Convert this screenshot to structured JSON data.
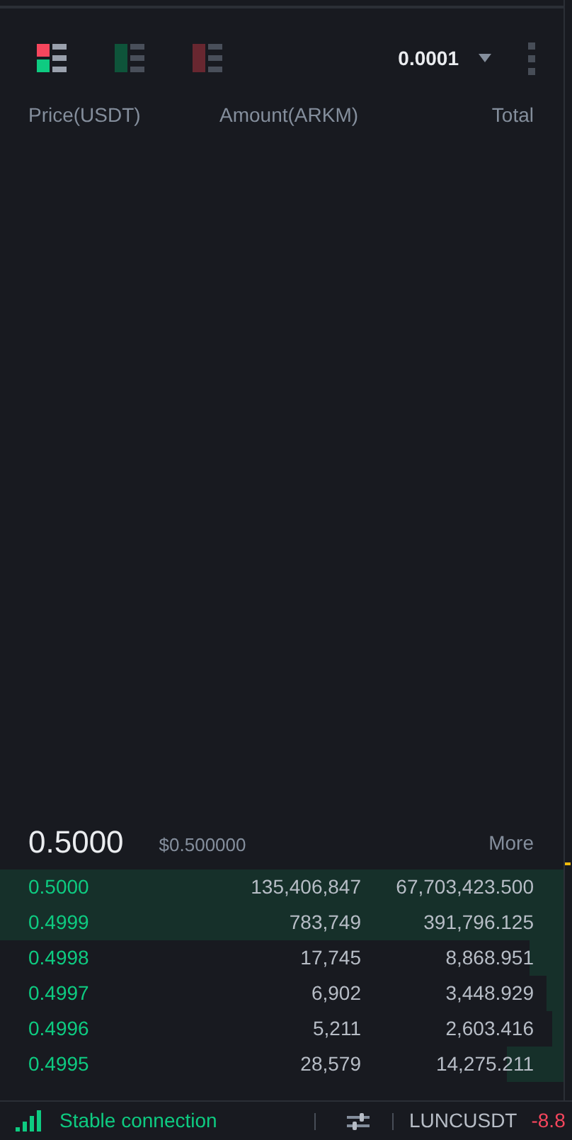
{
  "view_modes": [
    {
      "kind": "both",
      "selected": true
    },
    {
      "kind": "bids",
      "selected": false
    },
    {
      "kind": "asks",
      "selected": false
    }
  ],
  "precision": {
    "value": "0.0001"
  },
  "columns": [
    "Price(USDT)",
    "Amount(ARKM)",
    "Total"
  ],
  "last_price": {
    "price": "0.5000",
    "usd": "$0.500000",
    "more": "More"
  },
  "bids": [
    {
      "price": "0.5000",
      "amount": "135,406,847",
      "total": "67,703,423.500"
    },
    {
      "price": "0.4999",
      "amount": "783,749",
      "total": "391,796.125"
    },
    {
      "price": "0.4998",
      "amount": "17,745",
      "total": "8,868.951"
    },
    {
      "price": "0.4997",
      "amount": "6,902",
      "total": "3,448.929"
    },
    {
      "price": "0.4996",
      "amount": "5,211",
      "total": "2,603.416"
    },
    {
      "price": "0.4995",
      "amount": "28,579",
      "total": "14,275.211"
    }
  ],
  "status_bar": {
    "connection": "Stable connection",
    "ticker": {
      "symbol": "LUNCUSDT",
      "change": "-8.8"
    }
  }
}
